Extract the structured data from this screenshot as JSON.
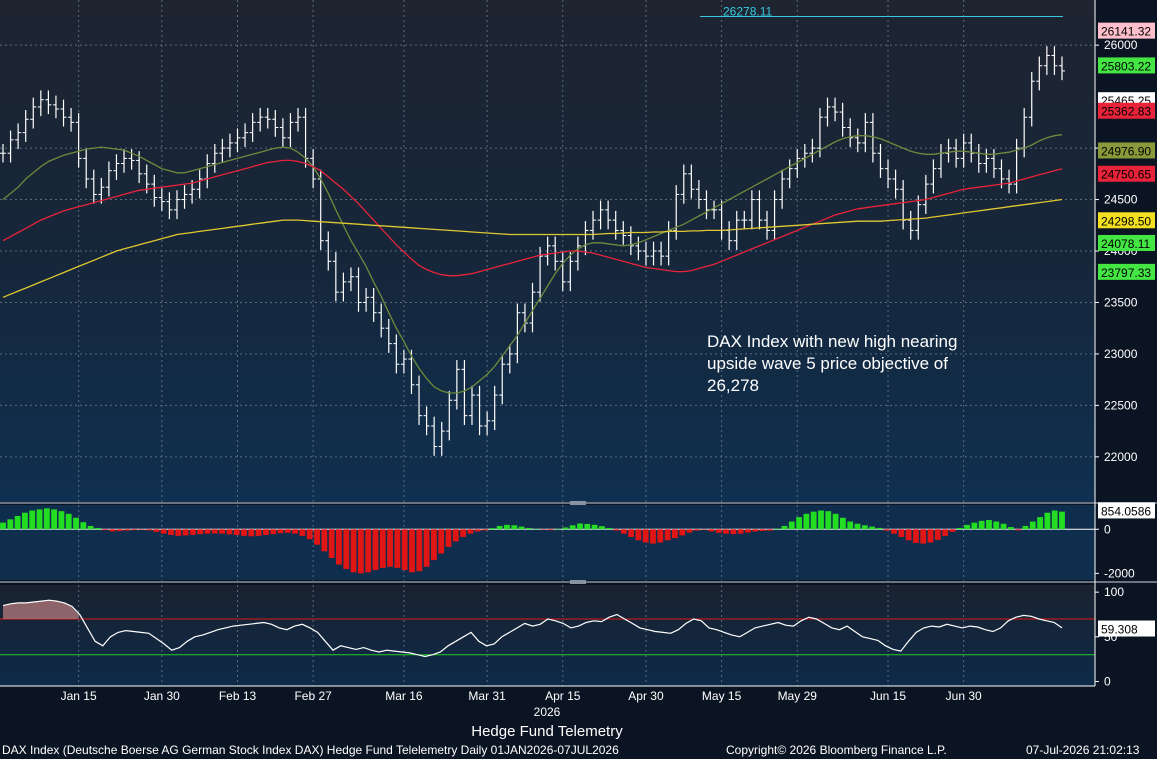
{
  "chart_data": [
    {
      "type": "line",
      "panel": "price",
      "title": "",
      "ylim": [
        21600,
        26400
      ],
      "y_ticks": [
        22000,
        22500,
        23000,
        23500,
        24000,
        24500,
        25000,
        26000
      ],
      "x_tick_labels": [
        "Jan 15",
        "Jan 30",
        "Feb 13",
        "Feb 27",
        "Mar 16",
        "Mar 31",
        "Apr 15",
        "Apr 30",
        "May 15",
        "May 29",
        "Jun 15",
        "Jun 30"
      ],
      "x_label_year": "2026",
      "x_label_series": "Hedge Fund Telemetry",
      "grid": true,
      "price_tags": [
        {
          "value": 26141.32,
          "label": "26141.32",
          "bg": "#ffc0cb",
          "fg": "#000000"
        },
        {
          "value": 25803.22,
          "label": "25803.22",
          "bg": "#44e644",
          "fg": "#000000"
        },
        {
          "value": 25465.25,
          "label": "25465.25",
          "bg": "#ffffff",
          "fg": "#000000"
        },
        {
          "value": 25362.83,
          "label": "25362.83",
          "bg": "#e8233a",
          "fg": "#000000"
        },
        {
          "value": 24976.9,
          "label": "24976.90",
          "bg": "#8a9a3a",
          "fg": "#000000"
        },
        {
          "value": 24750.65,
          "label": "24750.65",
          "bg": "#e8233a",
          "fg": "#000000"
        },
        {
          "value": 24298.5,
          "label": "24298.50",
          "bg": "#f2e020",
          "fg": "#000000"
        },
        {
          "value": 24078.11,
          "label": "24078.11",
          "bg": "#44e644",
          "fg": "#000000"
        },
        {
          "value": 23797.33,
          "label": "23797.33",
          "bg": "#44e644",
          "fg": "#000000"
        }
      ],
      "target_line": {
        "value": 26278.11,
        "label": "26278.11",
        "color": "#38c8e0"
      },
      "annotation": "DAX Index with new high nearing upside wave 5 price objective of 26,278",
      "series": [
        {
          "name": "",
          "color": "#ffffff",
          "values": [
            24950,
            25080,
            25150,
            25280,
            25400,
            25470,
            25420,
            25380,
            25300,
            25250,
            24900,
            24700,
            24550,
            24620,
            24780,
            24850,
            24900,
            24880,
            24750,
            24650,
            24520,
            24480,
            24400,
            24500,
            24550,
            24600,
            24700,
            24850,
            24950,
            25000,
            25050,
            25100,
            25150,
            25250,
            25300,
            25280,
            25200,
            25100,
            25250,
            25300,
            24900,
            24700,
            24100,
            23900,
            23600,
            23700,
            23750,
            23500,
            23550,
            23400,
            23250,
            23100,
            22900,
            22950,
            22700,
            22400,
            22300,
            22100,
            22250,
            22550,
            22850,
            22400,
            22600,
            22300,
            22350,
            22600,
            22900,
            23000,
            23400,
            23300,
            23600,
            23950,
            24050,
            23900,
            23700,
            23900,
            24050,
            24200,
            24300,
            24400,
            24300,
            24200,
            24150,
            24050,
            24000,
            23950,
            24000,
            23950,
            24200,
            24550,
            24750,
            24600,
            24500,
            24400,
            24400,
            24200,
            24100,
            24300,
            24300,
            24500,
            24300,
            24200,
            24500,
            24700,
            24800,
            24900,
            24950,
            25000,
            25300,
            25400,
            25350,
            25200,
            25100,
            25050,
            25250,
            24950,
            24800,
            24700,
            24600,
            24300,
            24200,
            24450,
            24650,
            24800,
            24950,
            25000,
            24900,
            25050,
            24950,
            24850,
            24900,
            24800,
            24700,
            24650,
            25000,
            25300,
            25650,
            25800,
            25900,
            25800,
            25750
          ]
        },
        {
          "name": "",
          "color": "#6f8a3c",
          "values": [
            24500,
            24560,
            24620,
            24700,
            24760,
            24820,
            24870,
            24900,
            24930,
            24950,
            24970,
            24990,
            25000,
            25010,
            25000,
            24990,
            24980,
            24950,
            24920,
            24880,
            24840,
            24800,
            24780,
            24760,
            24760,
            24780,
            24800,
            24820,
            24840,
            24860,
            24880,
            24900,
            24920,
            24940,
            24960,
            24980,
            25000,
            25010,
            25000,
            24960,
            24900,
            24820,
            24700,
            24560,
            24400,
            24250,
            24100,
            23980,
            23850,
            23700,
            23560,
            23400,
            23250,
            23120,
            22980,
            22860,
            22760,
            22680,
            22640,
            22620,
            22620,
            22640,
            22680,
            22740,
            22800,
            22880,
            22980,
            23080,
            23180,
            23300,
            23420,
            23540,
            23660,
            23780,
            23880,
            23960,
            24020,
            24060,
            24080,
            24080,
            24070,
            24060,
            24050,
            24060,
            24080,
            24110,
            24140,
            24170,
            24200,
            24230,
            24260,
            24300,
            24340,
            24380,
            24420,
            24460,
            24500,
            24540,
            24580,
            24620,
            24660,
            24700,
            24740,
            24780,
            24820,
            24860,
            24900,
            24940,
            24980,
            25020,
            25060,
            25090,
            25110,
            25120,
            25120,
            25110,
            25090,
            25060,
            25030,
            25000,
            24970,
            24950,
            24940,
            24940,
            24950,
            24960,
            24970,
            24970,
            24960,
            24950,
            24940,
            24940,
            24950,
            24960,
            24980,
            25000,
            25030,
            25070,
            25100,
            25120,
            25130
          ]
        },
        {
          "name": "",
          "color": "#e8233a",
          "values": [
            24100,
            24140,
            24180,
            24220,
            24260,
            24300,
            24330,
            24360,
            24390,
            24410,
            24430,
            24450,
            24470,
            24490,
            24510,
            24530,
            24550,
            24570,
            24590,
            24600,
            24610,
            24620,
            24630,
            24640,
            24650,
            24660,
            24680,
            24700,
            24720,
            24740,
            24760,
            24780,
            24800,
            24820,
            24840,
            24860,
            24870,
            24880,
            24880,
            24870,
            24850,
            24820,
            24780,
            24720,
            24660,
            24600,
            24530,
            24460,
            24380,
            24300,
            24220,
            24140,
            24060,
            23990,
            23920,
            23860,
            23820,
            23790,
            23770,
            23760,
            23760,
            23770,
            23780,
            23800,
            23820,
            23840,
            23860,
            23880,
            23900,
            23920,
            23940,
            23960,
            23970,
            23980,
            23990,
            24000,
            24000,
            23990,
            23980,
            23960,
            23940,
            23920,
            23900,
            23880,
            23860,
            23840,
            23830,
            23820,
            23810,
            23800,
            23800,
            23810,
            23830,
            23850,
            23870,
            23900,
            23930,
            23960,
            23990,
            24020,
            24050,
            24080,
            24110,
            24140,
            24170,
            24200,
            24230,
            24260,
            24290,
            24320,
            24350,
            24370,
            24390,
            24410,
            24420,
            24430,
            24440,
            24450,
            24460,
            24470,
            24480,
            24490,
            24500,
            24520,
            24540,
            24560,
            24580,
            24600,
            24610,
            24620,
            24630,
            24640,
            24650,
            24660,
            24680,
            24700,
            24720,
            24740,
            24760,
            24780,
            24800
          ]
        },
        {
          "name": "",
          "color": "#e0c830",
          "values": [
            23550,
            23580,
            23610,
            23640,
            23670,
            23700,
            23730,
            23760,
            23790,
            23820,
            23850,
            23880,
            23910,
            23940,
            23970,
            24000,
            24020,
            24040,
            24060,
            24080,
            24100,
            24120,
            24140,
            24160,
            24170,
            24180,
            24190,
            24200,
            24210,
            24220,
            24230,
            24240,
            24250,
            24260,
            24270,
            24280,
            24290,
            24300,
            24300,
            24300,
            24295,
            24290,
            24285,
            24280,
            24275,
            24270,
            24265,
            24260,
            24255,
            24250,
            24245,
            24240,
            24235,
            24230,
            24225,
            24220,
            24215,
            24210,
            24205,
            24200,
            24195,
            24190,
            24185,
            24180,
            24175,
            24170,
            24165,
            24160,
            24160,
            24160,
            24160,
            24160,
            24160,
            24160,
            24160,
            24160,
            24160,
            24160,
            24160,
            24165,
            24170,
            24170,
            24175,
            24180,
            24180,
            24180,
            24185,
            24185,
            24190,
            24190,
            24190,
            24195,
            24195,
            24200,
            24200,
            24200,
            24205,
            24210,
            24215,
            24220,
            24225,
            24230,
            24235,
            24240,
            24245,
            24250,
            24255,
            24260,
            24265,
            24270,
            24275,
            24280,
            24285,
            24290,
            24290,
            24290,
            24290,
            24295,
            24300,
            24305,
            24310,
            24315,
            24320,
            24330,
            24340,
            24350,
            24360,
            24370,
            24380,
            24390,
            24400,
            24410,
            24420,
            24430,
            24440,
            24450,
            24460,
            24470,
            24480,
            24490,
            24500
          ]
        }
      ]
    },
    {
      "type": "bar",
      "panel": "histogram",
      "ylim": [
        -2300,
        1100
      ],
      "y_ticks": [
        0,
        -2000
      ],
      "last_value": {
        "value": 854.0586,
        "label": "854.0586",
        "bg": "#ffffff",
        "fg": "#000000"
      },
      "values": [
        300,
        450,
        600,
        750,
        850,
        900,
        950,
        900,
        820,
        700,
        520,
        320,
        150,
        60,
        -40,
        -100,
        -80,
        -60,
        -40,
        -20,
        -50,
        -120,
        -200,
        -260,
        -300,
        -280,
        -250,
        -220,
        -200,
        -190,
        -200,
        -230,
        -260,
        -300,
        -320,
        -300,
        -260,
        -220,
        -180,
        -160,
        -200,
        -300,
        -450,
        -700,
        -1000,
        -1300,
        -1600,
        -1800,
        -1950,
        -2000,
        -1950,
        -1850,
        -1750,
        -1700,
        -1750,
        -1850,
        -1950,
        -1900,
        -1700,
        -1400,
        -1100,
        -800,
        -550,
        -350,
        -200,
        -100,
        -50,
        50,
        150,
        200,
        180,
        120,
        60,
        20,
        -20,
        -40,
        20,
        80,
        180,
        260,
        240,
        200,
        140,
        60,
        -60,
        -200,
        -350,
        -500,
        -600,
        -650,
        -600,
        -500,
        -400,
        -280,
        -150,
        -60,
        -20,
        -100,
        -160,
        -200,
        -220,
        -200,
        -150,
        -100,
        -80,
        -60,
        30,
        150,
        350,
        550,
        700,
        800,
        850,
        820,
        700,
        520,
        350,
        250,
        180,
        120,
        60,
        -60,
        -200,
        -350,
        -500,
        -620,
        -650,
        -600,
        -480,
        -300,
        -120,
        60,
        200,
        300,
        380,
        420,
        350,
        250,
        100,
        -50,
        150,
        350,
        550,
        750,
        850,
        800
      ]
    },
    {
      "type": "line",
      "panel": "rsi",
      "ylim": [
        -5,
        108
      ],
      "y_ticks": [
        100,
        50,
        0
      ],
      "upper_band": 70,
      "lower_band": 30,
      "last_value": {
        "value": 59.308,
        "label": "59.308",
        "bg": "#ffffff",
        "fg": "#000000"
      },
      "values": [
        85,
        87,
        88,
        88,
        89,
        90,
        91,
        90,
        88,
        84,
        75,
        60,
        45,
        40,
        50,
        55,
        57,
        56,
        55,
        54,
        48,
        42,
        35,
        38,
        45,
        50,
        52,
        55,
        58,
        60,
        62,
        63,
        64,
        65,
        66,
        64,
        60,
        58,
        62,
        64,
        60,
        55,
        45,
        35,
        40,
        38,
        36,
        38,
        35,
        33,
        35,
        34,
        33,
        32,
        30,
        28,
        30,
        33,
        40,
        45,
        50,
        55,
        45,
        40,
        42,
        50,
        55,
        60,
        65,
        62,
        64,
        70,
        68,
        65,
        60,
        62,
        66,
        68,
        67,
        72,
        75,
        70,
        65,
        60,
        58,
        56,
        55,
        54,
        58,
        65,
        70,
        68,
        60,
        58,
        55,
        52,
        50,
        55,
        60,
        62,
        64,
        66,
        63,
        62,
        68,
        72,
        70,
        65,
        60,
        58,
        62,
        56,
        50,
        48,
        46,
        40,
        36,
        34,
        45,
        55,
        60,
        62,
        61,
        64,
        62,
        60,
        62,
        61,
        58,
        56,
        60,
        68,
        72,
        74,
        73,
        70,
        68,
        66,
        60
      ]
    }
  ],
  "footer": {
    "left": "DAX Index (Deutsche Boerse AG German Stock Index DAX) Hedge Fund Telelemetry Daily 01JAN2026-07JUL2026",
    "center": "Copyright© 2026 Bloomberg Finance L.P.",
    "right": "07-Jul-2026 21:02:13"
  }
}
